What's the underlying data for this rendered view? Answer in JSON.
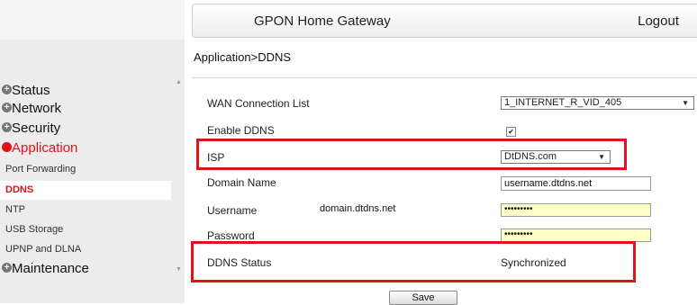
{
  "header": {
    "title": "GPON Home Gateway",
    "logout": "Logout"
  },
  "breadcrumb": "Application>DDNS",
  "sidebar": {
    "menus": [
      {
        "label": "Status"
      },
      {
        "label": "Network"
      },
      {
        "label": "Security"
      },
      {
        "label": "Application",
        "active": true
      },
      {
        "label": "Maintenance"
      }
    ],
    "sub_items": [
      "Port Forwarding",
      "DDNS",
      "NTP",
      "USB Storage",
      "UPNP and DLNA"
    ],
    "selected_sub": "DDNS"
  },
  "form": {
    "wan_label": "WAN Connection List",
    "wan_value": "1_INTERNET_R_VID_405",
    "enable_label": "Enable DDNS",
    "enable_checked": true,
    "isp_label": "ISP",
    "isp_value": "DtDNS.com",
    "domain_label": "Domain Name",
    "domain_value": "username.dtdns.net",
    "username_label": "Username",
    "username_note": "domain.dtdns.net",
    "username_value": "•••••••••",
    "password_label": "Password",
    "password_value": "•••••••••",
    "status_label": "DDNS Status",
    "status_value": "Synchronized"
  },
  "save_label": "Save",
  "colors": {
    "accent": "#e0131c",
    "highlight_box": "#e0131c",
    "password_bg": "#ffffc8"
  }
}
